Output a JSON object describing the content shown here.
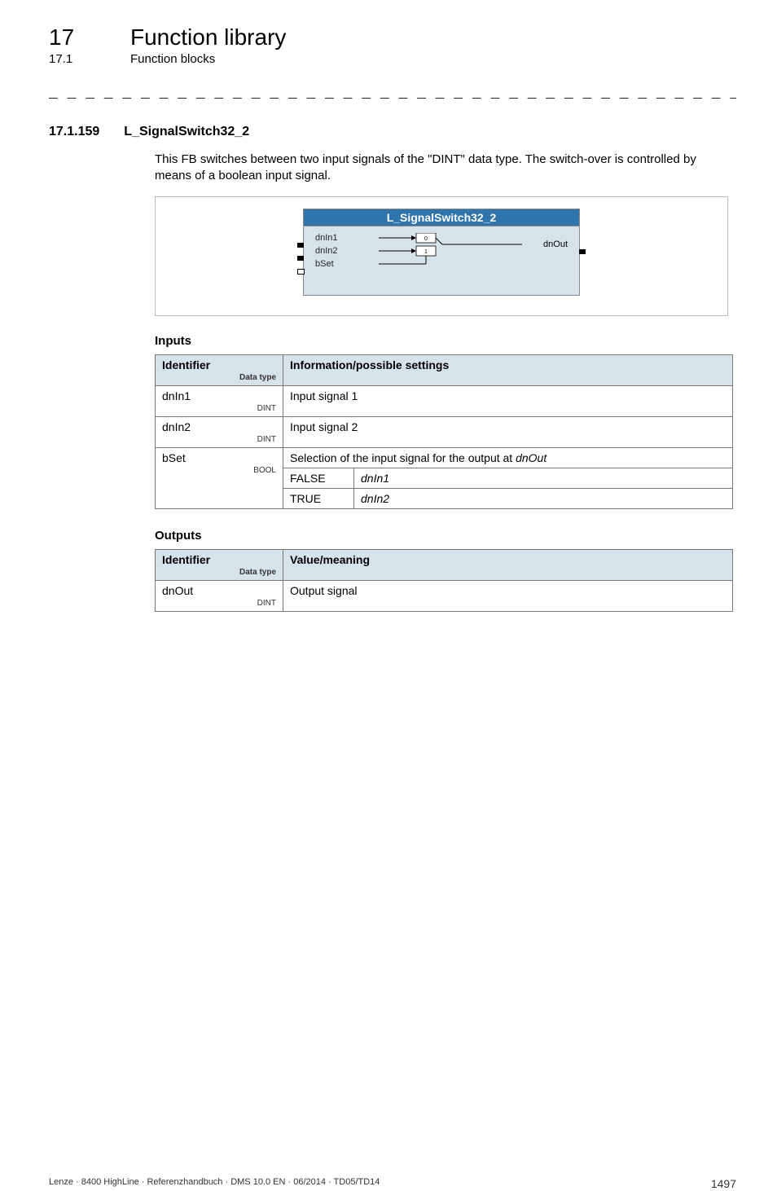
{
  "header": {
    "chapter_number": "17",
    "chapter_title": "Function library",
    "subsection_number": "17.1",
    "subsection_title": "Function blocks"
  },
  "separator": "_ _ _ _ _ _ _ _ _ _ _ _ _ _ _ _ _ _ _ _ _ _ _ _ _ _ _ _ _ _ _ _ _ _ _ _ _ _ _ _ _ _ _ _ _ _ _ _ _ _ _ _ _ _ _ _ _ _ _ _ _ _ _ _",
  "section": {
    "number": "17.1.159",
    "name": "L_SignalSwitch32_2"
  },
  "intro": "This FB switches between two input signals of the \"DINT\" data type. The switch-over is controlled by means of a boolean input signal.",
  "diagram": {
    "block_title": "L_SignalSwitch32_2",
    "inputs": [
      "dnIn1",
      "dnIn2",
      "bSet"
    ],
    "output": "dnOut",
    "switch_labels": [
      "0",
      "1"
    ]
  },
  "inputs_heading": "Inputs",
  "inputs_table": {
    "headers": {
      "identifier": "Identifier",
      "datatype_label": "Data type",
      "info": "Information/possible settings"
    },
    "rows": [
      {
        "name": "dnIn1",
        "datatype": "DINT",
        "desc": "Input signal 1"
      },
      {
        "name": "dnIn2",
        "datatype": "DINT",
        "desc": "Input signal 2"
      }
    ],
    "bset": {
      "name": "bSet",
      "datatype": "BOOL",
      "desc": "Selection of the input signal for the output at ",
      "desc_ref": "dnOut",
      "options": [
        {
          "value": "FALSE",
          "meaning": "dnIn1"
        },
        {
          "value": "TRUE",
          "meaning": "dnIn2"
        }
      ]
    }
  },
  "outputs_heading": "Outputs",
  "outputs_table": {
    "headers": {
      "identifier": "Identifier",
      "datatype_label": "Data type",
      "value": "Value/meaning"
    },
    "rows": [
      {
        "name": "dnOut",
        "datatype": "DINT",
        "desc": "Output signal"
      }
    ]
  },
  "footer": {
    "left": "Lenze · 8400 HighLine · Referenzhandbuch · DMS 10.0 EN · 06/2014 · TD05/TD14",
    "page": "1497"
  }
}
